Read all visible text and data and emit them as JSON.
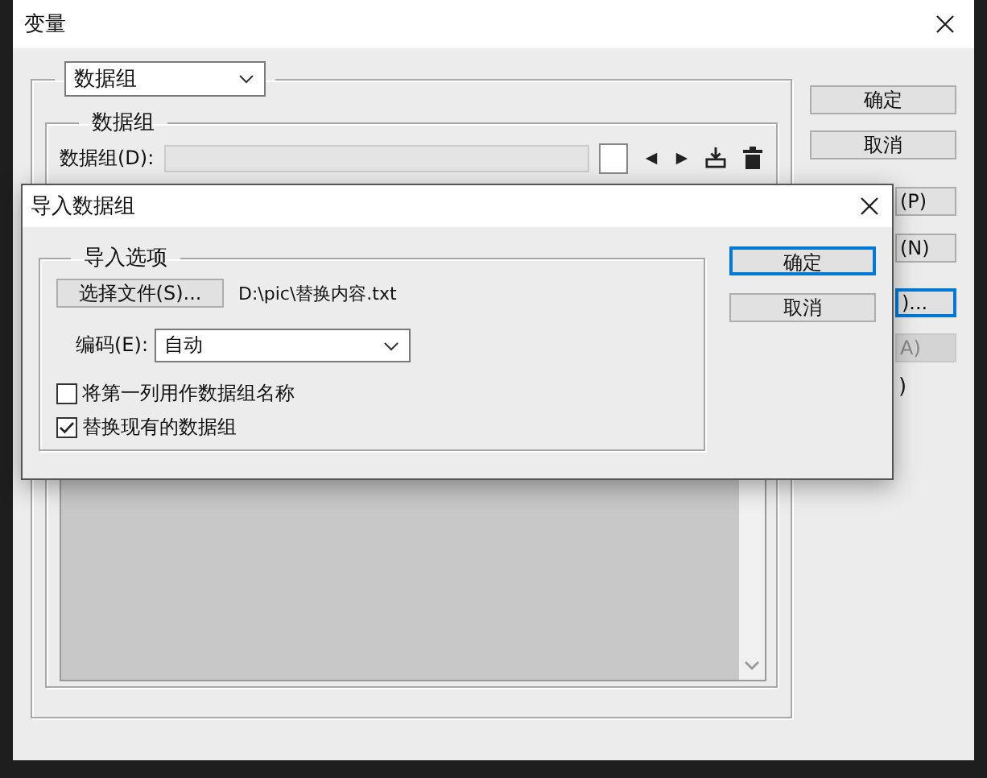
{
  "window": {
    "title": "变量"
  },
  "group_selector": {
    "value": "数据组"
  },
  "data_group": {
    "legend": "数据组",
    "label": "数据组(D):"
  },
  "side_buttons": [
    {
      "label": "确定",
      "kind": "full",
      "disabled": false,
      "focused": false
    },
    {
      "label": "取消",
      "kind": "full",
      "disabled": false,
      "focused": false
    },
    {
      "label": "(P)",
      "kind": "covered",
      "disabled": false,
      "focused": false
    },
    {
      "label": "(N)",
      "kind": "covered",
      "disabled": false,
      "focused": false
    },
    {
      "label": ")...",
      "kind": "covered",
      "disabled": false,
      "focused": true
    },
    {
      "label": "A)",
      "kind": "covered",
      "disabled": true,
      "focused": false
    }
  ],
  "side_fragment": ")",
  "dialog": {
    "title": "导入数据组",
    "group_legend": "导入选项",
    "choose_file_button": "选择文件(S)...",
    "file_path": "D:\\pic\\替换内容.txt",
    "encoding": {
      "label": "编码(E):",
      "value": "自动"
    },
    "options": [
      {
        "label": "将第一列用作数据组名称",
        "checked": false
      },
      {
        "label": "替换现有的数据组",
        "checked": true
      }
    ],
    "buttons": [
      {
        "label": "确定",
        "default": true
      },
      {
        "label": "取消",
        "default": false
      }
    ]
  }
}
